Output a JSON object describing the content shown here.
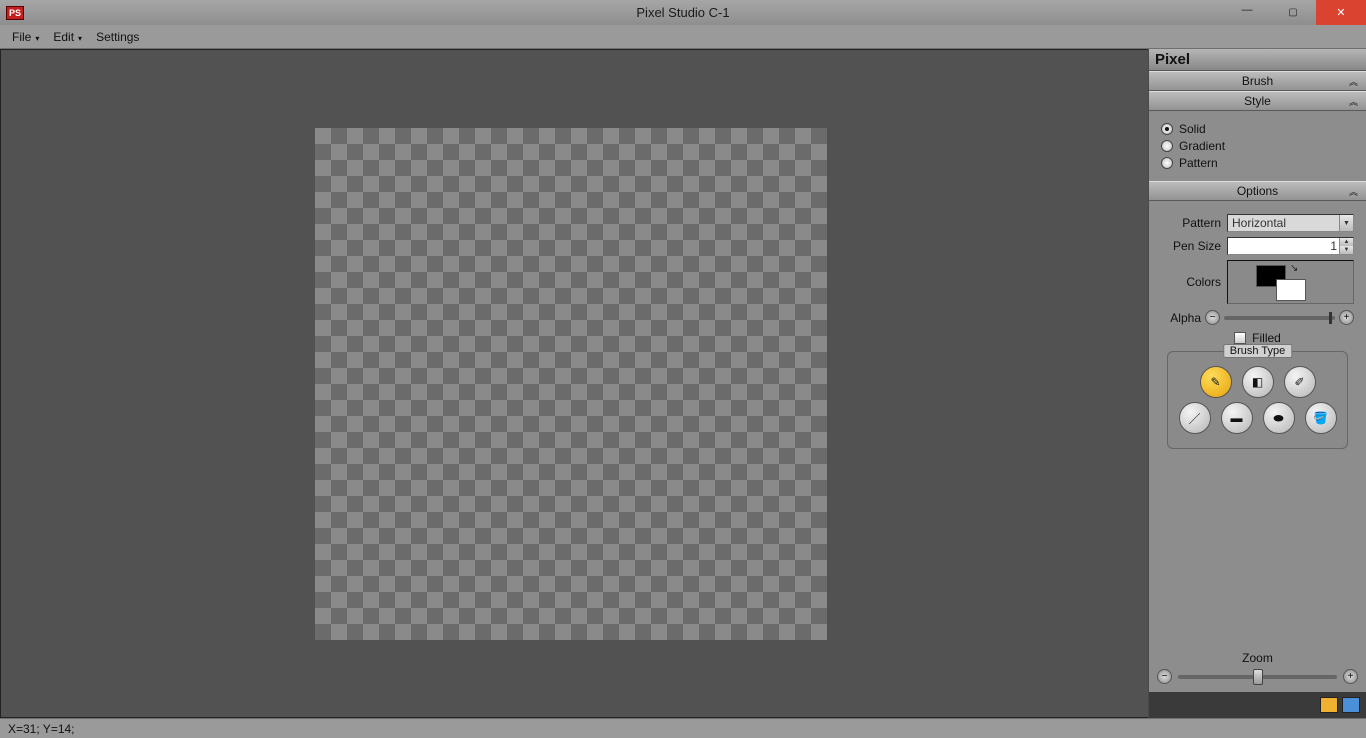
{
  "app": {
    "icon_text": "PS",
    "title": "Pixel Studio C-1"
  },
  "menubar": {
    "items": [
      "File",
      "Edit",
      "Settings"
    ]
  },
  "panel": {
    "title": "Pixel",
    "sections": {
      "brush": "Brush",
      "style": "Style",
      "options": "Options"
    },
    "style_radios": {
      "solid": "Solid",
      "gradient": "Gradient",
      "pattern": "Pattern",
      "selected": "solid"
    },
    "options": {
      "pattern_label": "Pattern",
      "pattern_value": "Horizontal",
      "pensize_label": "Pen Size",
      "pensize_value": "1",
      "colors_label": "Colors",
      "colors_fg": "#000000",
      "colors_bg": "#ffffff",
      "alpha_label": "Alpha",
      "filled_label": "Filled",
      "filled_checked": false
    },
    "brush_type": {
      "legend": "Brush Type",
      "tools": [
        "pencil",
        "eraser",
        "eyedropper",
        "line",
        "rectangle",
        "ellipse",
        "fill"
      ],
      "active": "pencil"
    },
    "zoom": {
      "label": "Zoom"
    }
  },
  "status": {
    "coords": "X=31; Y=14;"
  }
}
